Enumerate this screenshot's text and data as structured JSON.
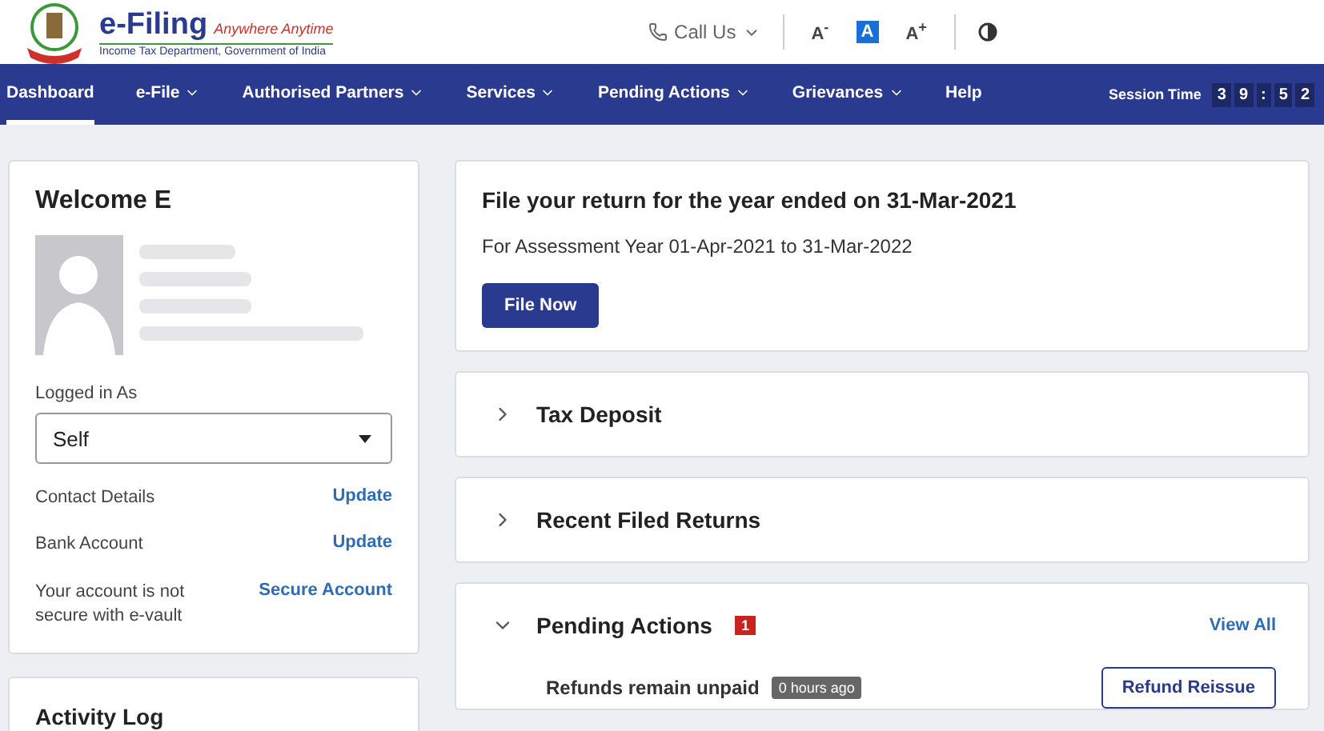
{
  "header": {
    "logo": {
      "title": "e-Filing",
      "tagline": "Anywhere Anytime",
      "subtitle": "Income Tax Department, Government of India"
    },
    "call_us": "Call Us",
    "font_controls": [
      {
        "label": "A$^{-}$",
        "selected": false
      },
      {
        "label": "A",
        "selected": true
      },
      {
        "label": "A$^{+}$",
        "selected": false
      }
    ]
  },
  "nav": {
    "items": [
      {
        "label": "Dashboard",
        "dropdown": false,
        "selected": true
      },
      {
        "label": "e-File",
        "dropdown": true,
        "selected": false
      },
      {
        "label": "Authorised Partners",
        "dropdown": true,
        "selected": false
      },
      {
        "label": "Services",
        "dropdown": true,
        "selected": false
      },
      {
        "label": "Pending Actions",
        "dropdown": true,
        "selected": false
      },
      {
        "label": "Grievances",
        "dropdown": true,
        "selected": false
      },
      {
        "label": "Help",
        "dropdown": false,
        "selected": false
      }
    ],
    "session": {
      "label": "Session Time",
      "digits": [
        "3",
        "9",
        ":",
        "5",
        "2"
      ]
    }
  },
  "profile": {
    "welcome": "Welcome E",
    "logged_in_label": "Logged in As",
    "logged_in_value": "Self",
    "rows": [
      {
        "label": "Contact Details",
        "action": "Update"
      },
      {
        "label": "Bank Account",
        "action": "Update"
      },
      {
        "label": "Your account is not secure with e-vault",
        "action": "Secure Account"
      }
    ]
  },
  "activity_log": {
    "title": "Activity Log"
  },
  "file_return": {
    "title": "File your return for the year ended on 31-Mar-2021",
    "subtitle": "For Assessment Year 01-Apr-2021 to 31-Mar-2022",
    "button": "File Now"
  },
  "sections": [
    {
      "title": "Tax Deposit",
      "expanded": false
    },
    {
      "title": "Recent Filed Returns",
      "expanded": false
    },
    {
      "title": "Pending Actions",
      "expanded": true,
      "badge": "1",
      "link": "View All",
      "items": [
        {
          "text": "Refunds remain unpaid",
          "time": "0 hours ago",
          "button": "Refund Reissue"
        }
      ]
    }
  ]
}
